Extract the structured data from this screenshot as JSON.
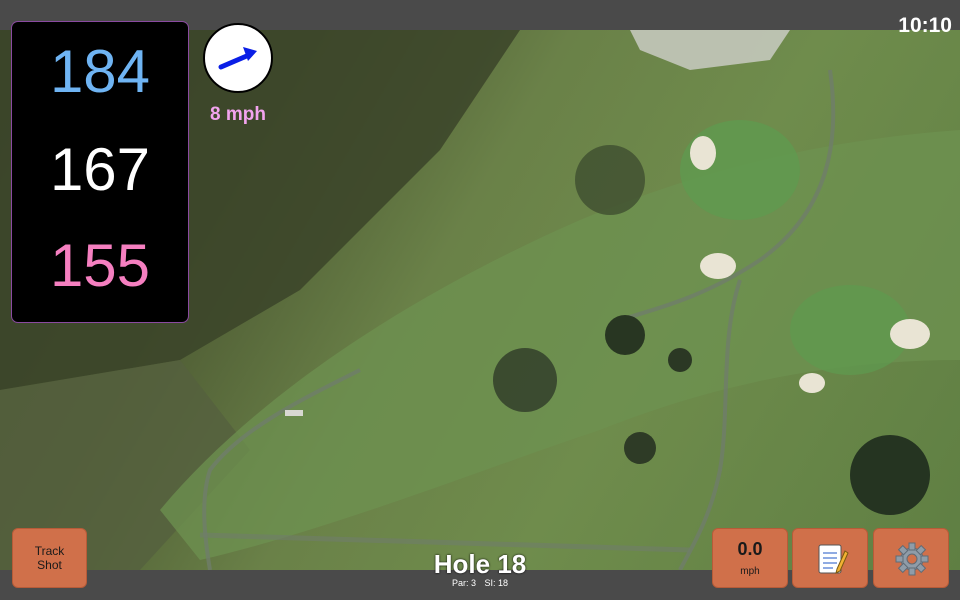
{
  "status_bar": {
    "time": "10:10"
  },
  "distances": {
    "back": "184",
    "middle": "167",
    "front": "155"
  },
  "wind": {
    "speed": "8 mph",
    "arrow_icon": "wind-direction-arrow-icon",
    "arrow_color": "#0a1ee6"
  },
  "hole": {
    "title": "Hole 18",
    "par": "Par: 3",
    "stroke_index": "SI: 18"
  },
  "buttons": {
    "track_shot": "Track Shot",
    "speed_value": "0.0",
    "speed_unit": "mph",
    "notes_icon": "notepad-icon",
    "settings_icon": "gear-icon"
  },
  "colors": {
    "back_distance": "#6fb4f3",
    "middle_distance": "#ffffff",
    "front_distance": "#f57fc0",
    "wind_text": "#f2a3ee",
    "button_bg": "#d0704a"
  }
}
